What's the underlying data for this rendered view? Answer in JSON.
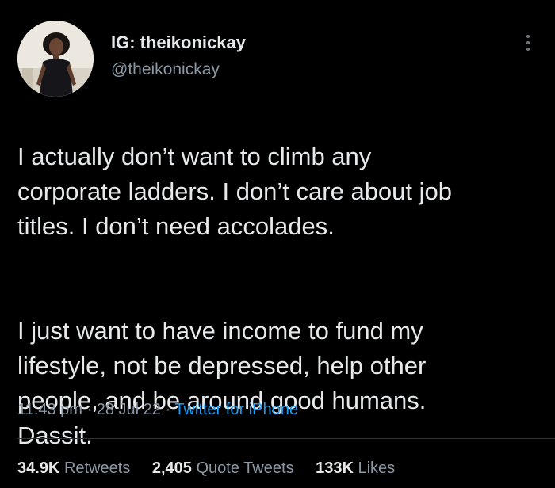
{
  "user": {
    "display_name": "IG: theikonickay",
    "handle": "@theikonickay",
    "avatar_icon": "profile-photo"
  },
  "tweet": {
    "paragraphs": [
      "I actually don’t want to climb any\ncorporate ladders. I don’t care about job\ntitles. I don’t need accolades.",
      "I just want to have income to fund my\nlifestyle, not be depressed, help other\npeople, and be around good humans.\nDassit."
    ],
    "time": "11:43 pm",
    "date": "28 Jul 22",
    "source": "Twitter for iPhone",
    "separator": "·"
  },
  "stats": {
    "retweets_count": "34.9K",
    "retweets_label": "Retweets",
    "quotes_count": "2,405",
    "quotes_label": "Quote Tweets",
    "likes_count": "133K",
    "likes_label": "Likes"
  },
  "colors": {
    "background": "#000000",
    "text": "#e7e9ea",
    "secondary": "#8b98a5",
    "link": "#1d9bf0",
    "divider": "#2f3336"
  },
  "icons": {
    "more": "more-vertical-icon"
  }
}
